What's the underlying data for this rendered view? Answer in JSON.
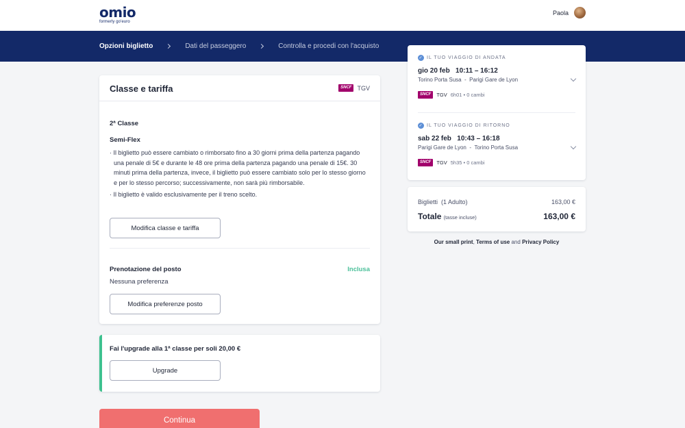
{
  "brand": {
    "name": "omio",
    "tagline": "formerly go'euro"
  },
  "user": {
    "name": "Paola"
  },
  "steps": [
    {
      "label": "Opzioni biglietto"
    },
    {
      "label": "Dati del passeggero"
    },
    {
      "label": "Controlla e procedi con l'acquisto"
    }
  ],
  "class_card": {
    "title": "Classe e tariffa",
    "operator": "SNCF",
    "train_type": "TGV",
    "class_label": "2ª Classe",
    "fare_name": "Semi-Flex",
    "rules": [
      "· Il biglietto può essere cambiato o rimborsato fino a 30 giorni prima della partenza pagando una penale di 5€ e durante le 48 ore prima della partenza pagando una penale di 15€. 30 minuti prima della partenza, invece, il biglietto può essere cambiato solo per lo stesso giorno e per lo stesso percorso; successivamente, non sarà più rimborsabile.",
      "· Il biglietto è valido esclusivamente per il treno scelto."
    ],
    "modify_fare_label": "Modifica classe e tariffa",
    "seat_title": "Prenotazione del posto",
    "seat_status": "Inclusa",
    "seat_pref": "Nessuna preferenza",
    "modify_seat_label": "Modifica preferenze posto"
  },
  "upgrade": {
    "text": "Fai l'upgrade alla 1ª classe per soli 20,00 €",
    "button_label": "Upgrade"
  },
  "continue_label": "Continua",
  "trips": {
    "outbound": {
      "heading": "IL TUO VIAGGIO DI ANDATA",
      "date": "gio 20 feb",
      "time": "10:11 – 16:12",
      "from": "Torino Porta Susa",
      "to": "Parigi Gare de Lyon",
      "operator": "SNCF",
      "train": "TGV",
      "duration": "6h01 • 0 cambi"
    },
    "return": {
      "heading": "IL TUO VIAGGIO DI RITORNO",
      "date": "sab 22 feb",
      "time": "10:43 – 16:18",
      "from": "Parigi Gare de Lyon",
      "to": "Torino Porta Susa",
      "operator": "SNCF",
      "train": "TGV",
      "duration": "5h35 • 0 cambi"
    },
    "route_separator": "-"
  },
  "price": {
    "tickets_label": "Biglietti",
    "tickets_qty": "(1 Adulto)",
    "tickets_value": "163,00 €",
    "total_label": "Totale",
    "total_note": "(tasse incluse)",
    "total_value": "163,00 €"
  },
  "legal": {
    "small_print": "Our small print",
    "comma": ",",
    "terms": "Terms of use",
    "and": "and",
    "privacy": "Privacy Policy"
  },
  "colors": {
    "navy": "#132968",
    "accent_red": "#f06f6f",
    "included_green": "#4cc09a",
    "sncf": "#a1006b"
  }
}
